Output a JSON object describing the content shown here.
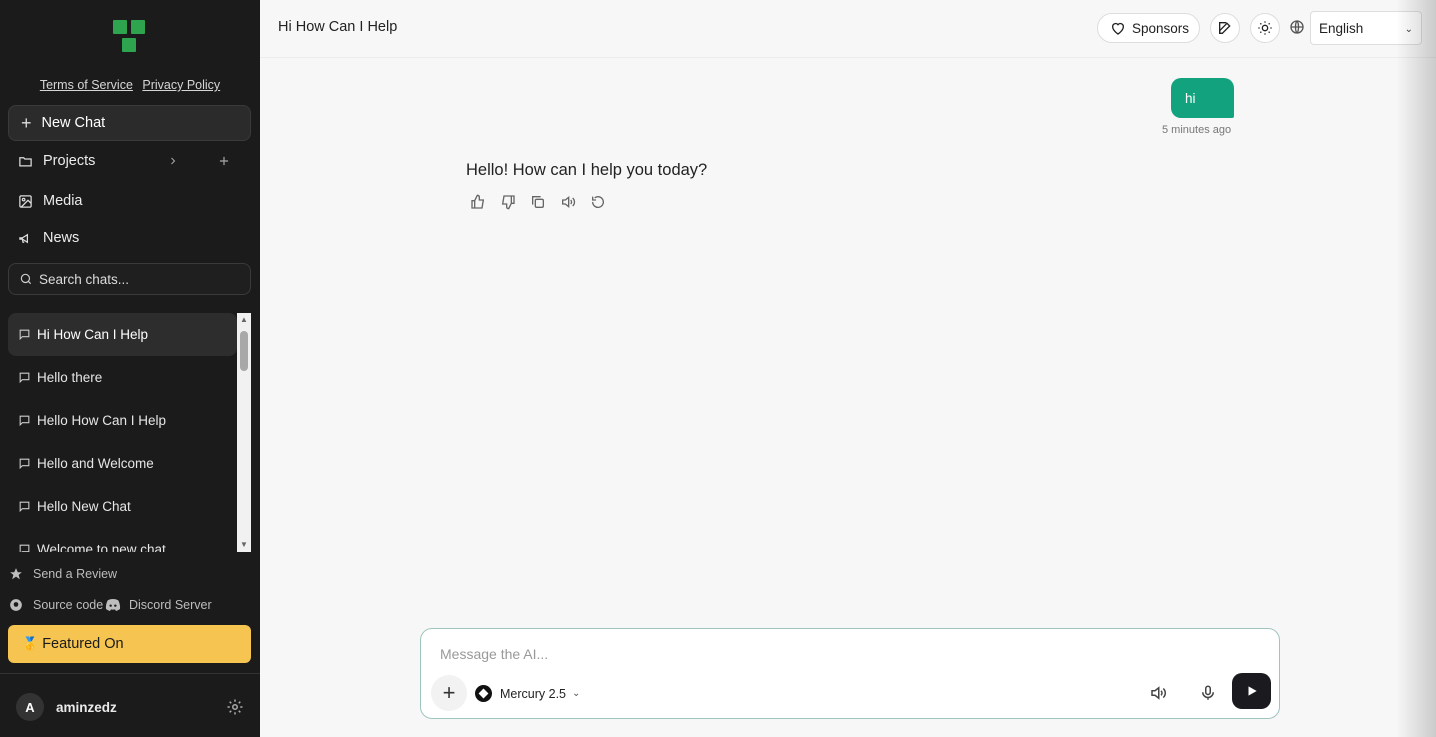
{
  "sidebar": {
    "legal": {
      "terms": "Terms of Service",
      "privacy": "Privacy Policy"
    },
    "new_chat": "New Chat",
    "nav": [
      {
        "label": "Projects",
        "icon": "folder-icon"
      },
      {
        "label": "Media",
        "icon": "image-icon"
      },
      {
        "label": "News",
        "icon": "megaphone-icon"
      }
    ],
    "search_placeholder": "Search chats...",
    "chats": [
      "Hi How Can I Help",
      "Hello there",
      "Hello How Can I Help",
      "Hello and Welcome",
      "Hello New Chat",
      "Welcome to new chat"
    ],
    "send_review": "Send a Review",
    "source_code": "Source code",
    "discord": "Discord Server",
    "featured": "Featured On",
    "user": {
      "initial": "A",
      "name": "aminzedz"
    }
  },
  "header": {
    "title": "Hi How Can I Help",
    "sponsors": "Sponsors",
    "language": "English"
  },
  "conversation": {
    "user_message": "hi",
    "user_time": "5 minutes ago",
    "assistant_message": "Hello! How can I help you today?"
  },
  "composer": {
    "placeholder": "Message the AI...",
    "model": "Mercury 2.5"
  },
  "colors": {
    "sidebar_bg": "#1b1b1b",
    "user_bubble": "#12a37e",
    "featured_bg": "#f5c451",
    "send_button": "#1b1b1f"
  }
}
